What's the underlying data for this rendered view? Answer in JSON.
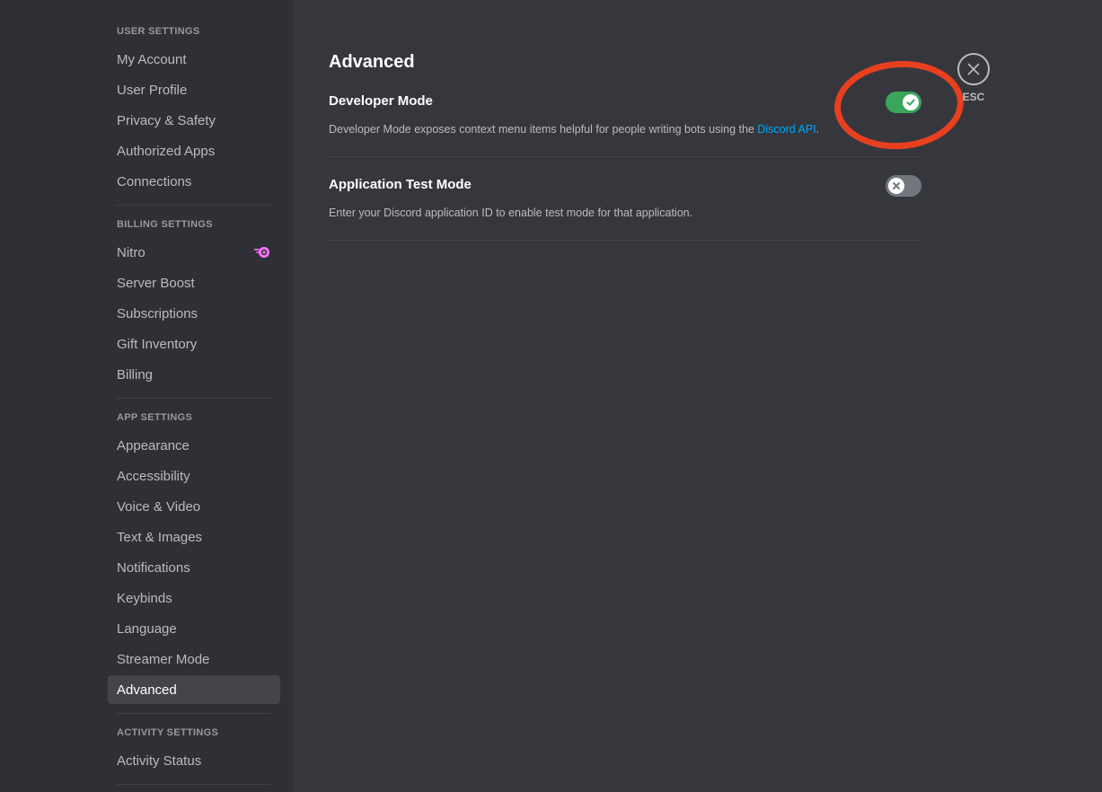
{
  "sidebar": {
    "sections": [
      {
        "header": "User Settings",
        "items": [
          {
            "label": "My Account"
          },
          {
            "label": "User Profile"
          },
          {
            "label": "Privacy & Safety"
          },
          {
            "label": "Authorized Apps"
          },
          {
            "label": "Connections"
          }
        ]
      },
      {
        "header": "Billing Settings",
        "items": [
          {
            "label": "Nitro",
            "badge": "nitro-icon"
          },
          {
            "label": "Server Boost"
          },
          {
            "label": "Subscriptions"
          },
          {
            "label": "Gift Inventory"
          },
          {
            "label": "Billing"
          }
        ]
      },
      {
        "header": "App Settings",
        "items": [
          {
            "label": "Appearance"
          },
          {
            "label": "Accessibility"
          },
          {
            "label": "Voice & Video"
          },
          {
            "label": "Text & Images"
          },
          {
            "label": "Notifications"
          },
          {
            "label": "Keybinds"
          },
          {
            "label": "Language"
          },
          {
            "label": "Streamer Mode"
          },
          {
            "label": "Advanced",
            "active": true
          }
        ]
      },
      {
        "header": "Activity Settings",
        "items": [
          {
            "label": "Activity Status"
          }
        ]
      }
    ]
  },
  "main": {
    "title": "Advanced",
    "settings": [
      {
        "title": "Developer Mode",
        "description": "Developer Mode exposes context menu items helpful for people writing bots using the ",
        "link_text": "Discord API",
        "description_suffix": ".",
        "enabled": true
      },
      {
        "title": "Application Test Mode",
        "description": "Enter your Discord application ID to enable test mode for that application.",
        "enabled": false
      }
    ]
  },
  "close": {
    "label": "ESC"
  },
  "colors": {
    "toggle_on": "#3ba55c",
    "toggle_off": "#72767d",
    "link": "#00a8fc",
    "annotation": "#e8401f",
    "nitro": "#ff73fa"
  }
}
